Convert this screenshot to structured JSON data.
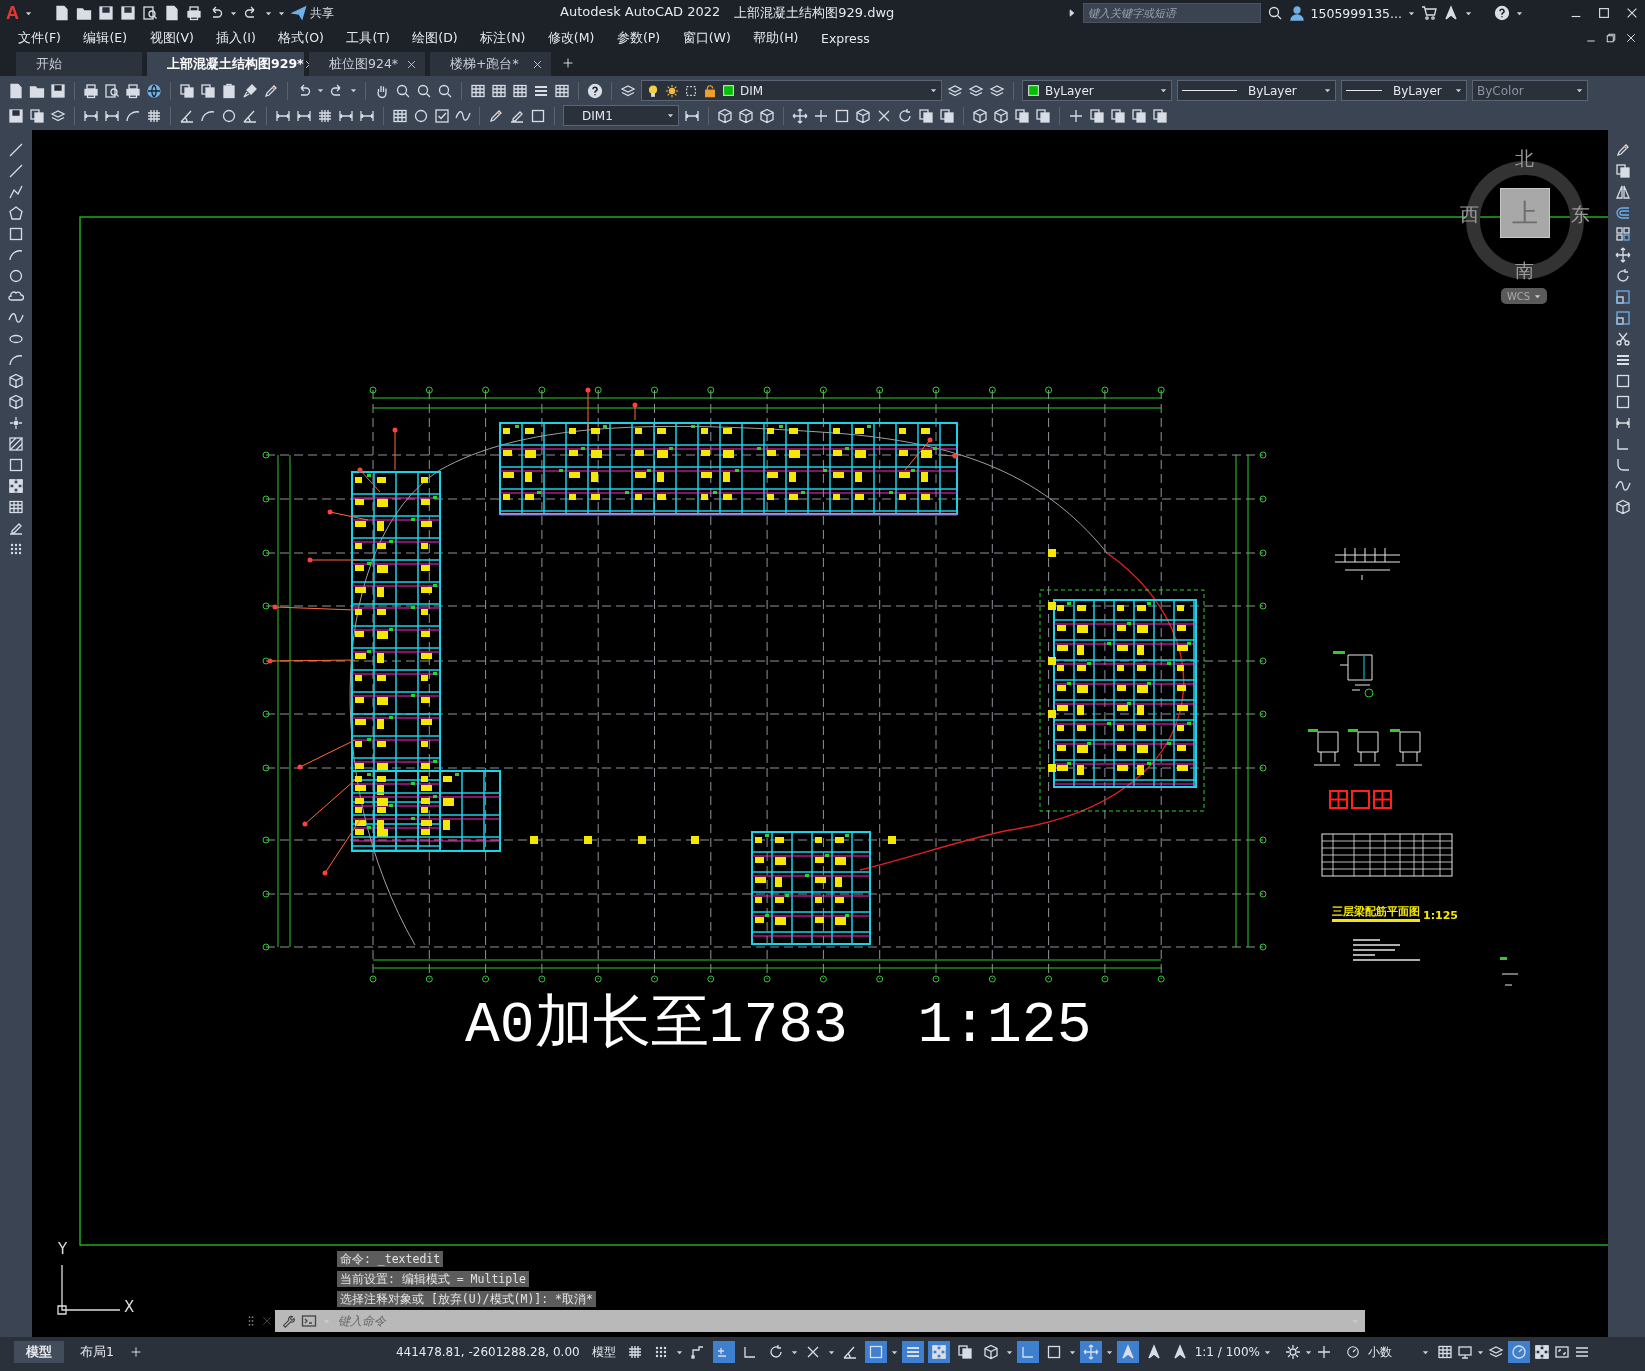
{
  "title_bar": {
    "logo": "A",
    "share_label": "共享",
    "app_title": "Autodesk AutoCAD 2022",
    "file_name": "上部混凝土结构图929.dwg",
    "search": {
      "placeholder": "键入关键字或短语"
    },
    "user": "1505999135..."
  },
  "menu": [
    "文件(F)",
    "编辑(E)",
    "视图(V)",
    "插入(I)",
    "格式(O)",
    "工具(T)",
    "绘图(D)",
    "标注(N)",
    "修改(M)",
    "参数(P)",
    "窗口(W)",
    "帮助(H)",
    "Express"
  ],
  "file_tabs": [
    {
      "label": "开始",
      "selected": false
    },
    {
      "label": "上部混凝土结构图929*",
      "selected": true
    },
    {
      "label": "桩位图924*",
      "selected": false
    },
    {
      "label": "楼梯+跑台*",
      "selected": false
    }
  ],
  "properties_toolbar": {
    "layer": "DIM",
    "color_setting": "ByLayer",
    "linetype": "ByLayer",
    "lineweight": "ByLayer",
    "plot_style": {
      "value": "ByColor",
      "disabled": true
    }
  },
  "dimension_style": "DIM1",
  "viewcube": {
    "north": "北",
    "west": "西",
    "top": "上",
    "east": "东",
    "south": "南",
    "coordinate_system": "WCS"
  },
  "drawing": {
    "plan_caption": "三层梁配筋平面图",
    "plan_scale": "1:125",
    "sheet_title": "A0加长至1783  1:125"
  },
  "ucs_icon": {
    "y_label": "Y",
    "x_label": "X"
  },
  "command_line": {
    "history": [
      "命令: _textedit",
      "当前设置: 编辑模式 = Multiple",
      "选择注释对象或 [放弃(U)/模式(M)]: *取消*"
    ],
    "placeholder": "键入命令"
  },
  "layout_tabs": [
    {
      "label": "模型",
      "selected": true
    },
    {
      "label": "布局1",
      "selected": false
    }
  ],
  "status_bar": {
    "coordinates": "441478.81, -2601288.28, 0.00",
    "space": "模型",
    "annotation_scale": "1:1 / 100%",
    "units": "小数",
    "toggles": [
      {
        "on": false
      },
      {
        "on": false
      },
      {
        "on": false
      },
      {
        "on": true
      },
      {
        "on": false
      },
      {
        "on": false
      },
      {
        "on": false
      },
      {
        "on": false
      },
      {
        "on": true
      },
      {
        "on": true
      },
      {
        "on": true
      },
      {
        "on": false
      },
      {
        "on": false
      },
      {
        "on": true
      },
      {
        "on": false
      },
      {
        "on": true
      },
      {
        "on": true
      },
      {
        "on": false
      },
      {
        "on": false
      }
    ]
  }
}
